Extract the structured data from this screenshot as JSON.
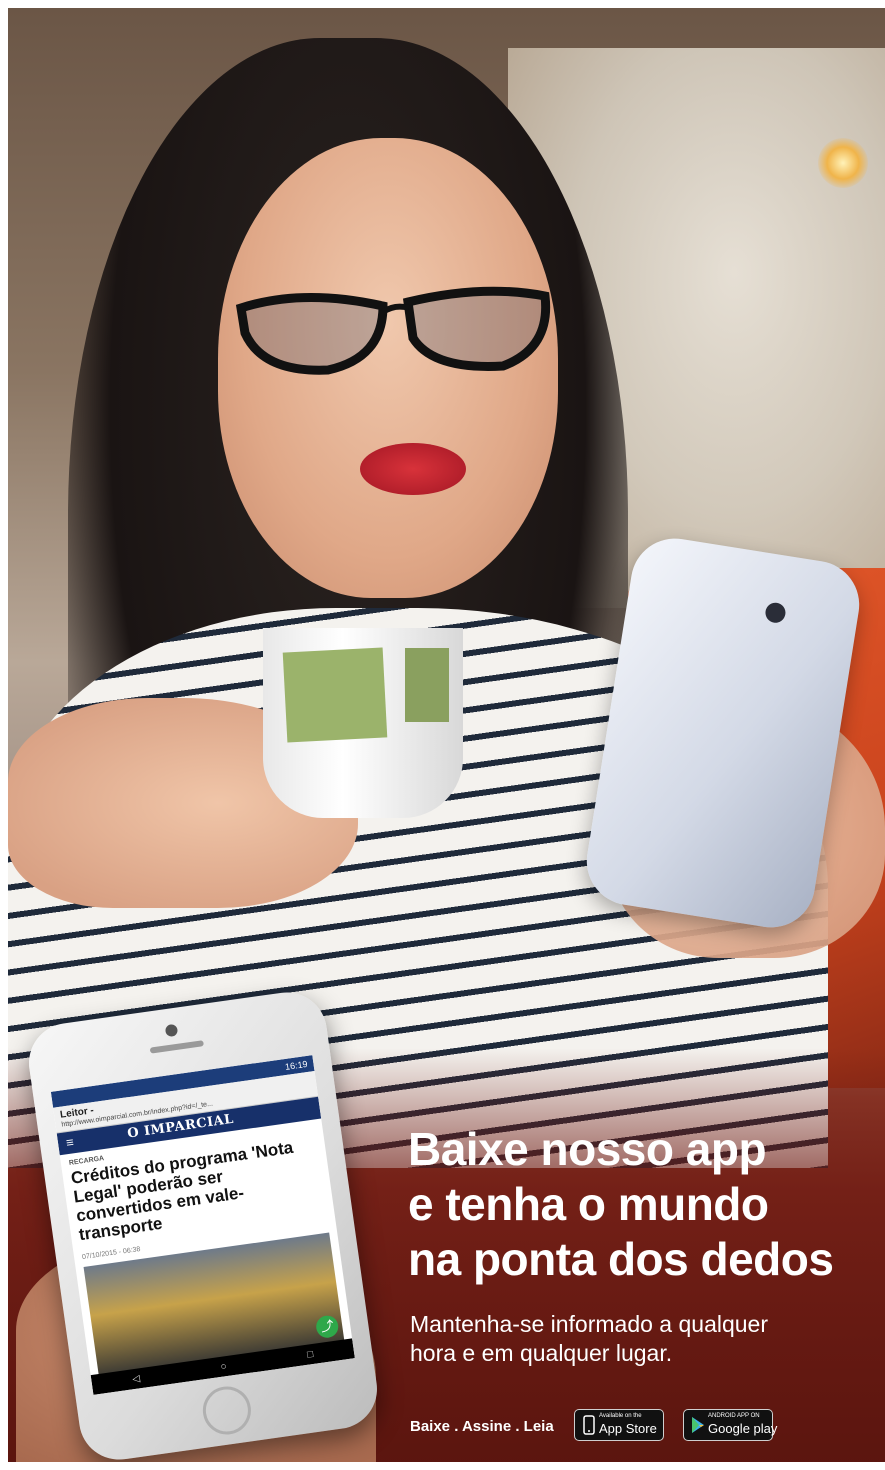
{
  "mockup_phone": {
    "status_time": "16:19",
    "browser_title": "Leitor -",
    "browser_url": "http://www.oimparcial.com.br/index.php?id=/_te...",
    "site_logo": "O IMPARCIAL",
    "menu_glyph": "≡",
    "article_kicker": "RECARGA",
    "article_headline": "Créditos do programa 'Nota Legal' poderão ser convertidos em vale-transporte",
    "article_date": "07/10/2015 - 06:38",
    "nav_back": "◁",
    "nav_home": "○",
    "nav_recent": "□",
    "share_icon": "share-icon"
  },
  "headline": {
    "line1": "Baixe nosso app",
    "line2": "e tenha o mundo",
    "line3": "na ponta dos dedos"
  },
  "subheadline": {
    "line1": "Mantenha-se informado a qualquer",
    "line2": "hora e em qualquer lugar."
  },
  "footer": {
    "tagline": "Baixe . Assine . Leia",
    "app_store_small": "Available on the",
    "app_store_big": "App Store",
    "google_play_small": "ANDROID APP ON",
    "google_play_big": "Google play"
  },
  "colors": {
    "headline_text": "#ffffff",
    "site_bar": "#17306a",
    "accent_red": "#b31f2b",
    "seat_orange": "#e2582a"
  }
}
